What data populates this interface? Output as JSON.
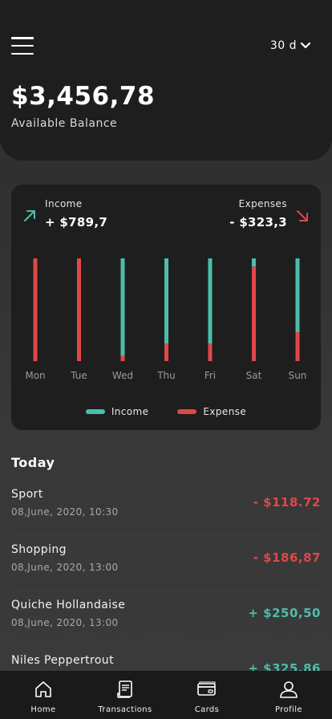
{
  "header": {
    "period_label": "30 d",
    "balance": "$3,456,78",
    "balance_label": "Available Balance"
  },
  "summary": {
    "income_label": "Income",
    "income_value": "+ $789,7",
    "expenses_label": "Expenses",
    "expenses_value": "- $323,3"
  },
  "colors": {
    "income": "#4dbdab",
    "expense": "#e04848",
    "card": "#1e1e1e"
  },
  "chart_data": {
    "type": "bar",
    "stacked": true,
    "categories": [
      "Mon",
      "Tue",
      "Wed",
      "Thu",
      "Fri",
      "Sat",
      "Sun"
    ],
    "series": [
      {
        "name": "Income",
        "values": [
          0,
          0,
          0.95,
          0.83,
          0.83,
          0.08,
          0.72
        ]
      },
      {
        "name": "Expense",
        "values": [
          1.0,
          1.0,
          0.05,
          0.17,
          0.17,
          0.92,
          0.28
        ]
      }
    ],
    "ylim": [
      0,
      1
    ],
    "grid": false,
    "legend": "bottom"
  },
  "legend": {
    "income": "Income",
    "expense": "Expense"
  },
  "section_title": "Today",
  "transactions": [
    {
      "name": "Sport",
      "date": "08,June, 2020, 10:30",
      "amount": "- $118.72",
      "type": "expense"
    },
    {
      "name": "Shopping",
      "date": "08,June, 2020, 13:00",
      "amount": "- $186,87",
      "type": "expense"
    },
    {
      "name": "Quiche Hollandaise",
      "date": "08,June, 2020, 13:00",
      "amount": "+ $250,50",
      "type": "income"
    },
    {
      "name": "Niles Peppertrout",
      "date": "",
      "amount": "+ $325,86",
      "type": "income"
    }
  ],
  "tabs": [
    {
      "label": "Home",
      "icon": "home-icon"
    },
    {
      "label": "Transactions",
      "icon": "receipt-icon"
    },
    {
      "label": "Cards",
      "icon": "card-icon"
    },
    {
      "label": "Profile",
      "icon": "user-icon"
    }
  ]
}
